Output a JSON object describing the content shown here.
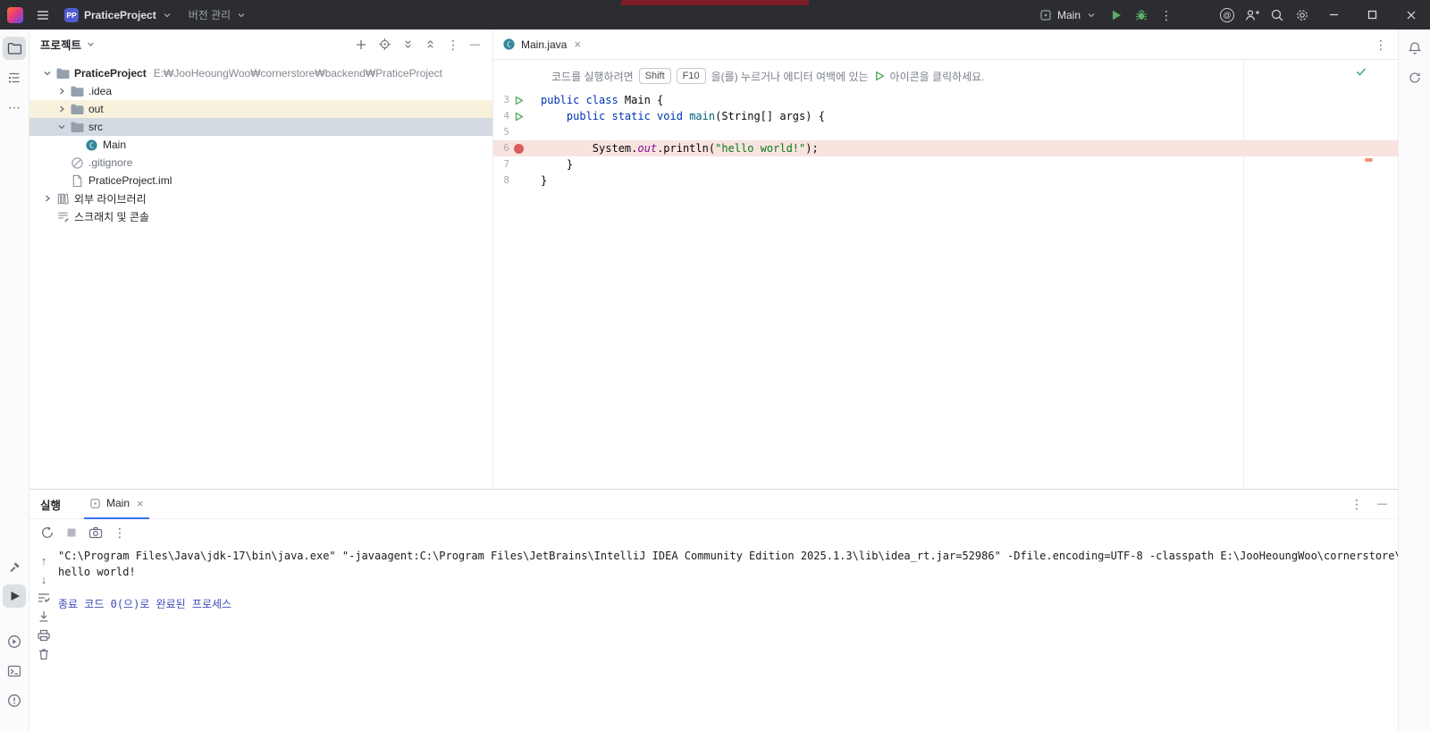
{
  "colors": {
    "titlebar_bg": "#2b2d30",
    "accent_blue": "#3574f0",
    "run_green": "#5fad65",
    "breakpoint_red": "#db5c5c",
    "keyword_blue": "#0033b3",
    "string_green": "#067d17",
    "field_purple": "#871094",
    "selected_row": "#d4dae1",
    "out_row_highlight": "#f8f2dc",
    "breakpoint_line_bg": "#f8e3df",
    "console_system_blue": "#3d4db7",
    "project_badge_bg": "#515cd0"
  },
  "icons": {
    "more_vertical": "⋮",
    "more_horizontal": "⋯",
    "hide_dash": "—",
    "up_arrow": "↑",
    "down_arrow": "↓",
    "close_x": "×",
    "at_sign": "@"
  },
  "titlebar": {
    "project_badge": "PP",
    "project_name": "PraticeProject",
    "vcs_label": "버전 관리",
    "run_config_name": "Main"
  },
  "project_panel": {
    "title": "프로젝트",
    "tree": [
      {
        "label": "PraticeProject",
        "path": "E:₩JooHeoungWoo₩cornerstore₩backend₩PraticeProject"
      },
      {
        "label": ".idea"
      },
      {
        "label": "out"
      },
      {
        "label": "src"
      },
      {
        "label": "Main"
      },
      {
        "label": ".gitignore"
      },
      {
        "label": "PraticeProject.iml"
      },
      {
        "label": "외부 라이브러리"
      },
      {
        "label": "스크래치 및 콘솔"
      }
    ]
  },
  "editor": {
    "tab_label": "Main.java",
    "banner": {
      "text_before": "코드를 실행하려면",
      "key_shift": "Shift",
      "key_f10": "F10",
      "text_mid": "을(를) 누르거나 에디터 여백에 있는",
      "text_after": "아이콘을 클릭하세요."
    },
    "code_lines": [
      {
        "num": 3,
        "run": true,
        "tokens": [
          {
            "t": "public class ",
            "c": "kw"
          },
          {
            "t": "Main {",
            "c": "pl"
          }
        ]
      },
      {
        "num": 4,
        "run": true,
        "tokens": [
          {
            "t": "    ",
            "c": "pl"
          },
          {
            "t": "public static void ",
            "c": "kw"
          },
          {
            "t": "main",
            "c": "fn"
          },
          {
            "t": "(String[] args) {",
            "c": "pl"
          }
        ]
      },
      {
        "num": 5,
        "tokens": []
      },
      {
        "num": 6,
        "bp": true,
        "hl": true,
        "tokens": [
          {
            "t": "        System.",
            "c": "pl"
          },
          {
            "t": "out",
            "c": "fld"
          },
          {
            "t": ".println(",
            "c": "pl"
          },
          {
            "t": "\"hello world!\"",
            "c": "str"
          },
          {
            "t": ");",
            "c": "pl"
          }
        ]
      },
      {
        "num": 7,
        "tokens": [
          {
            "t": "    }",
            "c": "pl"
          }
        ]
      },
      {
        "num": 8,
        "tokens": [
          {
            "t": "}",
            "c": "pl"
          }
        ]
      }
    ]
  },
  "run_panel": {
    "title": "실행",
    "tab_label": "Main",
    "console_lines": [
      "\"C:\\Program Files\\Java\\jdk-17\\bin\\java.exe\" \"-javaagent:C:\\Program Files\\JetBrains\\IntelliJ IDEA Community Edition 2025.1.3\\lib\\idea_rt.jar=52986\" -Dfile.encoding=UTF-8 -classpath E:\\JooHeoungWoo\\cornerstore\\backend\\PraticeP",
      "hello world!",
      "",
      "종료 코드 0(으)로 완료된 프로세스"
    ]
  }
}
